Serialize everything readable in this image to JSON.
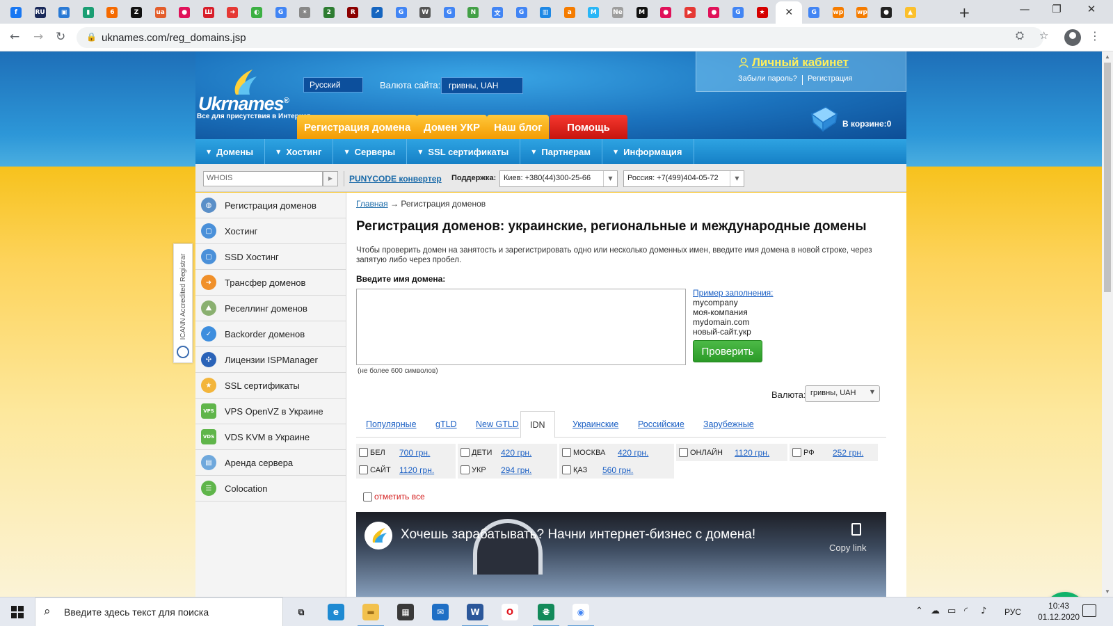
{
  "browser": {
    "tabs": [
      {
        "icon": "facebook-icon",
        "glyph": "f",
        "color": "#1877f2"
      },
      {
        "icon": "ru-icon",
        "glyph": "RU",
        "color": "#1a2a5a"
      },
      {
        "icon": "sanhelp-icon",
        "glyph": "▣",
        "color": "#2a7ad5"
      },
      {
        "icon": "book-icon",
        "glyph": "▮",
        "color": "#1a9e73"
      },
      {
        "icon": "six-icon",
        "glyph": "6",
        "color": "#f56a00"
      },
      {
        "icon": "z-icon",
        "glyph": "Z",
        "color": "#111111"
      },
      {
        "icon": "ua-icon",
        "glyph": "ua",
        "color": "#e35d2b"
      },
      {
        "icon": "chat-bubble-icon",
        "glyph": "●",
        "color": "#e0125a"
      },
      {
        "icon": "sh-icon",
        "glyph": "Ш",
        "color": "#d81e2a"
      },
      {
        "icon": "arrow-icon",
        "glyph": "➜",
        "color": "#e53935"
      },
      {
        "icon": "toggle-icon",
        "glyph": "◐",
        "color": "#3cb043"
      },
      {
        "icon": "google-icon",
        "glyph": "G",
        "color": "#4285f4"
      },
      {
        "icon": "sparkle-icon",
        "glyph": "✶",
        "color": "#888888"
      },
      {
        "icon": "two-icon",
        "glyph": "2",
        "color": "#2e7d32"
      },
      {
        "icon": "r-icon",
        "glyph": "R",
        "color": "#8b0000"
      },
      {
        "icon": "chart-line-icon",
        "glyph": "↗",
        "color": "#1565c0"
      },
      {
        "icon": "google-icon",
        "glyph": "G",
        "color": "#4285f4"
      },
      {
        "icon": "wikipedia-icon",
        "glyph": "W",
        "color": "#555555"
      },
      {
        "icon": "google-icon",
        "glyph": "G",
        "color": "#4285f4"
      },
      {
        "icon": "n-icon",
        "glyph": "N",
        "color": "#43a047"
      },
      {
        "icon": "translate-icon",
        "glyph": "文",
        "color": "#4285f4"
      },
      {
        "icon": "google-icon",
        "glyph": "G",
        "color": "#4285f4"
      },
      {
        "icon": "bar-chart-icon",
        "glyph": "▥",
        "color": "#1e88e5"
      },
      {
        "icon": "a-icon",
        "glyph": "a",
        "color": "#f57c00"
      },
      {
        "icon": "m-icon",
        "glyph": "M",
        "color": "#29b6f6"
      },
      {
        "icon": "text-tab-icon",
        "glyph": "Ne",
        "color": "#9e9e9e"
      },
      {
        "icon": "medium-icon",
        "glyph": "M",
        "color": "#111111"
      },
      {
        "icon": "chat-bubble-icon",
        "glyph": "●",
        "color": "#e0125a"
      },
      {
        "icon": "play-icon",
        "glyph": "▶",
        "color": "#e53935"
      },
      {
        "icon": "chat-bubble-icon",
        "glyph": "●",
        "color": "#e0125a"
      },
      {
        "icon": "google-icon",
        "glyph": "G",
        "color": "#4285f4"
      },
      {
        "icon": "star-icon",
        "glyph": "★",
        "color": "#d50000"
      },
      {
        "icon": "close-icon",
        "glyph": "✕",
        "color": "#333333",
        "active": true
      },
      {
        "icon": "google-icon",
        "glyph": "G",
        "color": "#4285f4"
      },
      {
        "icon": "wp-icon",
        "glyph": "wp",
        "color": "#f57c00"
      },
      {
        "icon": "wp-icon",
        "glyph": "wp",
        "color": "#f57c00"
      },
      {
        "icon": "record-icon",
        "glyph": "●",
        "color": "#222222"
      },
      {
        "icon": "drive-icon",
        "glyph": "▲",
        "color": "#fbc02d"
      }
    ],
    "url": "uknames.com/reg_domains.jsp"
  },
  "site": {
    "logo_text": "Ukrnames",
    "logo_reg": "®",
    "logo_tagline": "Все для присутствия в Интернет",
    "language": "Русский",
    "currency_label": "Валюта сайта:",
    "currency_value": "гривны, UAH",
    "top_buttons": [
      "Регистрация домена",
      "Домен УКР",
      "Наш блог",
      "Помощь"
    ],
    "cabinet": {
      "title": "Личный кабинет",
      "forgot": "Забыли пароль?",
      "register": "Регистрация"
    },
    "cart": "В корзине:0",
    "nav": [
      "Домены",
      "Хостинг",
      "Серверы",
      "SSL сертификаты",
      "Партнерам",
      "Информация"
    ],
    "whois_placeholder": "WHOIS",
    "punycode": "PUNYCODE конвертер",
    "support_label": "Поддержка:",
    "phones": [
      "Киев: +380(44)300-25-66",
      "Россия: +7(499)404-05-72"
    ],
    "icann": "ICANN Accredited Registrar",
    "sidebar": [
      {
        "label": "Регистрация доменов",
        "icon": "globe-icon",
        "color": "#5a8fc8",
        "glyph": "◍"
      },
      {
        "label": "Хостинг",
        "icon": "hosting-icon",
        "color": "#4a90d9",
        "glyph": "▢"
      },
      {
        "label": "SSD Хостинг",
        "icon": "ssd-icon",
        "color": "#4a90d9",
        "glyph": "▢"
      },
      {
        "label": "Трансфер доменов",
        "icon": "transfer-icon",
        "color": "#f0902a",
        "glyph": "➜"
      },
      {
        "label": "Реселлинг доменов",
        "icon": "reseller-icon",
        "color": "#8ab070",
        "glyph": "⛰"
      },
      {
        "label": "Backorder доменов",
        "icon": "checkmark-icon",
        "color": "#3e8ede",
        "glyph": "✓"
      },
      {
        "label": "Лицензии ISPManager",
        "icon": "isp-icon",
        "color": "#2a63b8",
        "glyph": "✣"
      },
      {
        "label": "SSL сертификаты",
        "icon": "star-icon",
        "color": "#f3b53b",
        "glyph": "★"
      },
      {
        "label": "VPS OpenVZ в Украине",
        "icon": "vps-icon",
        "color": "#5fb54a",
        "glyph": "VPS"
      },
      {
        "label": "VDS KVM в Украине",
        "icon": "vds-icon",
        "color": "#5fb54a",
        "glyph": "VDS"
      },
      {
        "label": "Аренда сервера",
        "icon": "server-icon",
        "color": "#6fa8dc",
        "glyph": "▤"
      },
      {
        "label": "Colocation",
        "icon": "colocation-icon",
        "color": "#5fb54a",
        "glyph": "☰"
      }
    ],
    "breadcrumb": {
      "home": "Главная",
      "arrow": "→",
      "current": "Регистрация доменов"
    },
    "title": "Регистрация доменов: украинские, региональные и международные домены",
    "intro": "Чтобы проверить домен на занятость и зарегистрировать одно или несколько доменных имен, введите имя домена в новой строке, через запятую либо через пробел.",
    "enter_label": "Введите имя домена:",
    "textarea_hint": "(не более 600 символов)",
    "example": {
      "link": "Пример заполнения:",
      "lines": [
        "mycompany",
        "моя-компания",
        "mydomain.com",
        "новый-сайт.укр"
      ]
    },
    "check_button": "Проверить",
    "currency2_label": "Валюта:",
    "currency2_value": "гривны, UAH",
    "tabs": [
      "Популярные",
      "gTLD",
      "New GTLD",
      "IDN",
      "Украинские",
      "Российские",
      "Зарубежные"
    ],
    "active_tab": "IDN",
    "domains_row1": [
      {
        "name": "БЕЛ",
        "price": "700 грн."
      },
      {
        "name": "ДЕТИ",
        "price": "420 грн."
      },
      {
        "name": "МОСКВА",
        "price": "420 грн."
      },
      {
        "name": "ОНЛАЙН",
        "price": "1120 грн."
      },
      {
        "name": "РФ",
        "price": "252 грн."
      }
    ],
    "domains_row2": [
      {
        "name": "САЙТ",
        "price": "1120 грн."
      },
      {
        "name": "УКР",
        "price": "294 грн."
      },
      {
        "name": "ҚАЗ",
        "price": "560 грн."
      }
    ],
    "mark_all": "отметить все",
    "video": {
      "title": "Хочешь зарабатывать? Начни интернет-бизнес с домена!",
      "copy": "Copy link"
    }
  },
  "taskbar": {
    "search_placeholder": "Введите здесь текст для поиска",
    "lang": "РУС",
    "time": "10:43",
    "date": "01.12.2020",
    "apps": [
      {
        "icon": "task-view-icon",
        "glyph": "⧉",
        "color": "transparent",
        "text": "#222222",
        "run": false
      },
      {
        "icon": "edge-icon",
        "glyph": "e",
        "color": "#1f8ad2",
        "text": "#ffffff",
        "run": false
      },
      {
        "icon": "explorer-icon",
        "glyph": "▬",
        "color": "#f2c14e",
        "text": "#a0711b",
        "run": true
      },
      {
        "icon": "store-icon",
        "glyph": "▦",
        "color": "#3a3a3a",
        "text": "#ffffff",
        "run": false
      },
      {
        "icon": "mail-icon",
        "glyph": "✉",
        "color": "#1f6fc5",
        "text": "#ffffff",
        "run": false
      },
      {
        "icon": "word-icon",
        "glyph": "W",
        "color": "#2b579a",
        "text": "#ffffff",
        "run": true
      },
      {
        "icon": "opera-icon",
        "glyph": "O",
        "color": "#ffffff",
        "text": "#e0121b",
        "run": false
      },
      {
        "icon": "app-icon",
        "glyph": "₴",
        "color": "#138a5a",
        "text": "#ffffff",
        "run": true
      },
      {
        "icon": "chrome-icon",
        "glyph": "◉",
        "color": "#ffffff",
        "text": "#4285f4",
        "run": true
      }
    ]
  },
  "colors": {
    "accent_orange": "#f39a00",
    "help_red": "#c5130d",
    "nav_blue": "#1580c6",
    "check_green": "#2b9a27",
    "link_blue": "#1a5fc4"
  }
}
